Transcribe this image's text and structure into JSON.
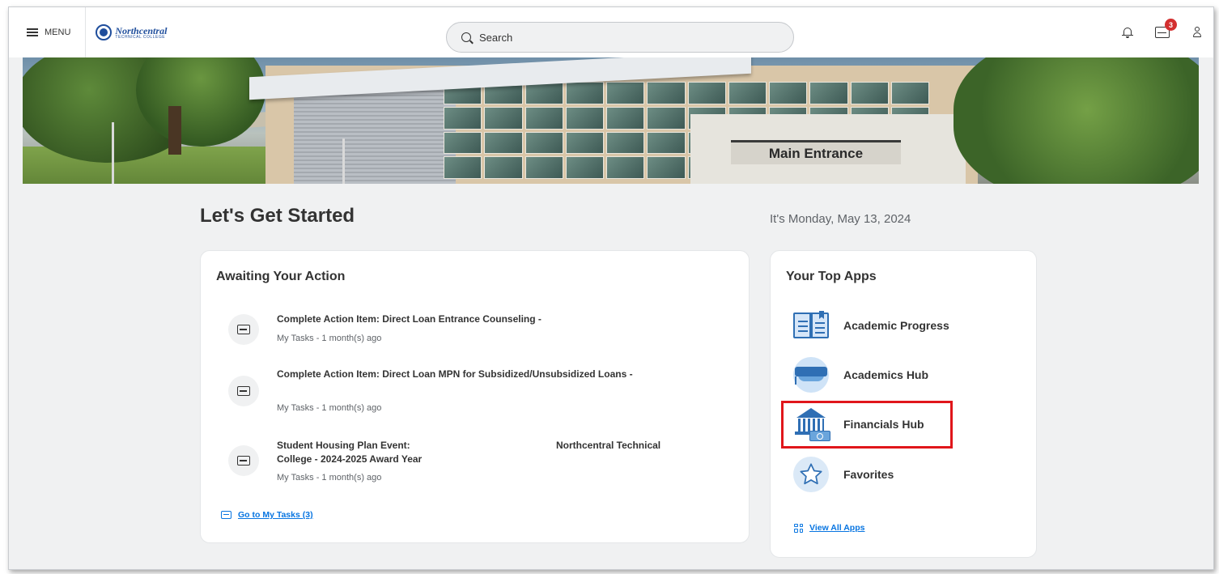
{
  "topbar": {
    "menu_label": "MENU",
    "logo_name": "Northcentral",
    "logo_sub": "TECHNICAL COLLEGE",
    "search_placeholder": "Search",
    "inbox_badge": "3"
  },
  "hero": {
    "sign_text": "Main Entrance"
  },
  "page": {
    "title": "Let's Get Started",
    "date": "It's Monday, May 13, 2024"
  },
  "awaiting": {
    "title": "Awaiting Your Action",
    "tasks": [
      {
        "title": "Complete Action Item: Direct Loan Entrance Counseling -",
        "meta": "My Tasks - 1 month(s) ago"
      },
      {
        "title": "Complete Action Item: Direct Loan MPN for Subsidized/Unsubsidized Loans -",
        "meta": "My Tasks - 1 month(s) ago"
      },
      {
        "title_line1_left": "Student Housing Plan Event:",
        "title_line1_right": "Northcentral Technical",
        "title_line2": "College - 2024-2025 Award Year",
        "meta": "My Tasks - 1 month(s) ago"
      }
    ],
    "go_to_tasks": "Go to My Tasks (3)"
  },
  "apps": {
    "title": "Your Top Apps",
    "items": [
      {
        "label": "Academic Progress",
        "icon": "book-icon"
      },
      {
        "label": "Academics Hub",
        "icon": "graduation-cap-icon"
      },
      {
        "label": "Financials Hub",
        "icon": "bank-icon"
      },
      {
        "label": "Favorites",
        "icon": "star-icon"
      }
    ],
    "view_all": "View All Apps"
  },
  "colors": {
    "link": "#0875e1",
    "highlight_box": "#e0161b",
    "badge": "#d32f2f",
    "icon_blue": "#2f6fb4"
  }
}
